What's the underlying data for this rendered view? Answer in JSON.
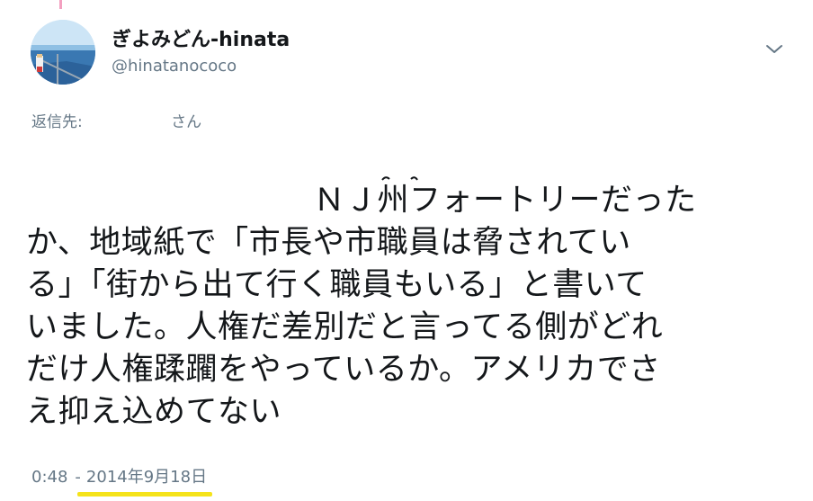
{
  "tweet": {
    "display_name": "ぎよみどん-hinata",
    "handle": "@hinatanococo",
    "reply_label": "返信先:",
    "reply_target": "さん",
    "text": "　　　　　　　　　ＮＪ州フォートリーだった\nか、地域紙で「市長や市職員は脅されてい\nる」「街から出て行く職員もいる」と書いて\nいました。人権だ差別だと言ってる側がどれ\nだけ人権蹂躙をやっているか。アメリカでさ\nえ抑え込めてない",
    "time": "0:48",
    "separator": "-",
    "date": "2014年9月18日",
    "icons": {
      "menu": "chevron-down-icon",
      "avatar": "avatar-image"
    },
    "colors": {
      "text": "#14171a",
      "secondary": "#657786",
      "highlight": "#f5e31a"
    }
  }
}
